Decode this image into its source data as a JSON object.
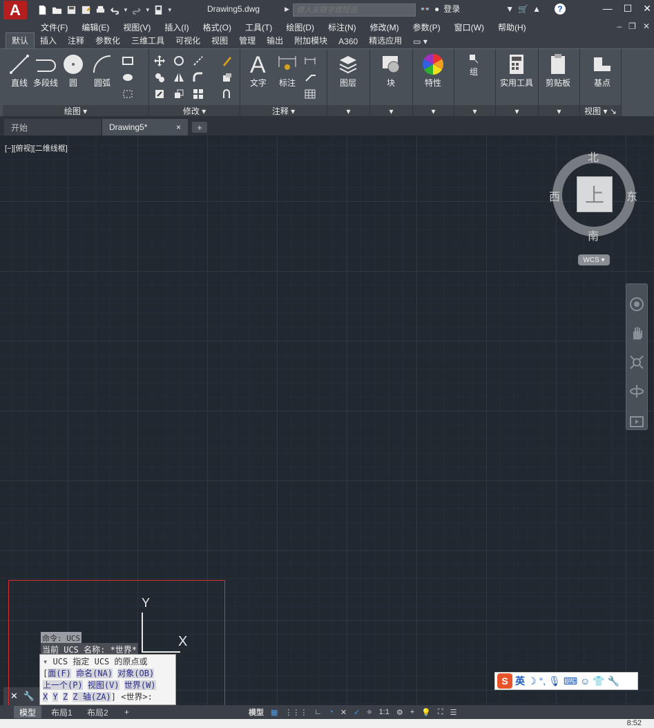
{
  "title_bar": {
    "document_title": "Drawing5.dwg",
    "search_placeholder": "键入关键字或短语",
    "login_label": "登录",
    "help_label": "?"
  },
  "menu": {
    "items": [
      "文件(F)",
      "编辑(E)",
      "视图(V)",
      "插入(I)",
      "格式(O)",
      "工具(T)",
      "绘图(D)",
      "标注(N)",
      "修改(M)",
      "参数(P)",
      "窗口(W)",
      "帮助(H)"
    ]
  },
  "ribbon_tabs": [
    "默认",
    "插入",
    "注释",
    "参数化",
    "三维工具",
    "可视化",
    "视图",
    "管理",
    "输出",
    "附加模块",
    "A360",
    "精选应用"
  ],
  "ribbon": {
    "draw_panel": {
      "title": "绘图",
      "line": "直线",
      "polyline": "多段线",
      "circle": "圆",
      "arc": "圆弧"
    },
    "modify_panel": {
      "title": "修改"
    },
    "annotation_panel": {
      "title": "注释",
      "text": "文字",
      "dimension": "标注"
    },
    "layers": "图层",
    "block": "块",
    "properties": "特性",
    "group": "组",
    "utilities": "实用工具",
    "clipboard": "剪贴板",
    "view_panel": {
      "title": "视图",
      "base": "基点"
    }
  },
  "file_tabs": {
    "start": "开始",
    "drawing": "Drawing5*",
    "close": "×",
    "add": "+"
  },
  "viewport": {
    "label": "[−][俯视][二维线框]"
  },
  "viewcube": {
    "north": "北",
    "south": "南",
    "east": "东",
    "west": "西",
    "face": "上",
    "wcs": "WCS"
  },
  "ucs_icon": {
    "x": "X",
    "y": "Y"
  },
  "command": {
    "history_1": "命令: UCS",
    "history_2": "当前 UCS 名称: *世界*",
    "prompt_line1": "UCS 指定 UCS 的原点或",
    "opt_face": "面(F)",
    "opt_named": "命名(NA)",
    "opt_object": "对象(OB)",
    "opt_previous": "上一个(P)",
    "opt_view": "视图(V)",
    "opt_world": "世界(W)",
    "opt_x": "X",
    "opt_y": "Y",
    "opt_z": "Z",
    "opt_za": "Z 轴(ZA)",
    "prompt_end": "] <世界>:"
  },
  "ime": {
    "lang": "英"
  },
  "layout_tabs": [
    "模型",
    "布局1",
    "布局2",
    "+"
  ],
  "status_bar": {
    "model": "模型",
    "scale": "1:1"
  },
  "clock": "8:52"
}
